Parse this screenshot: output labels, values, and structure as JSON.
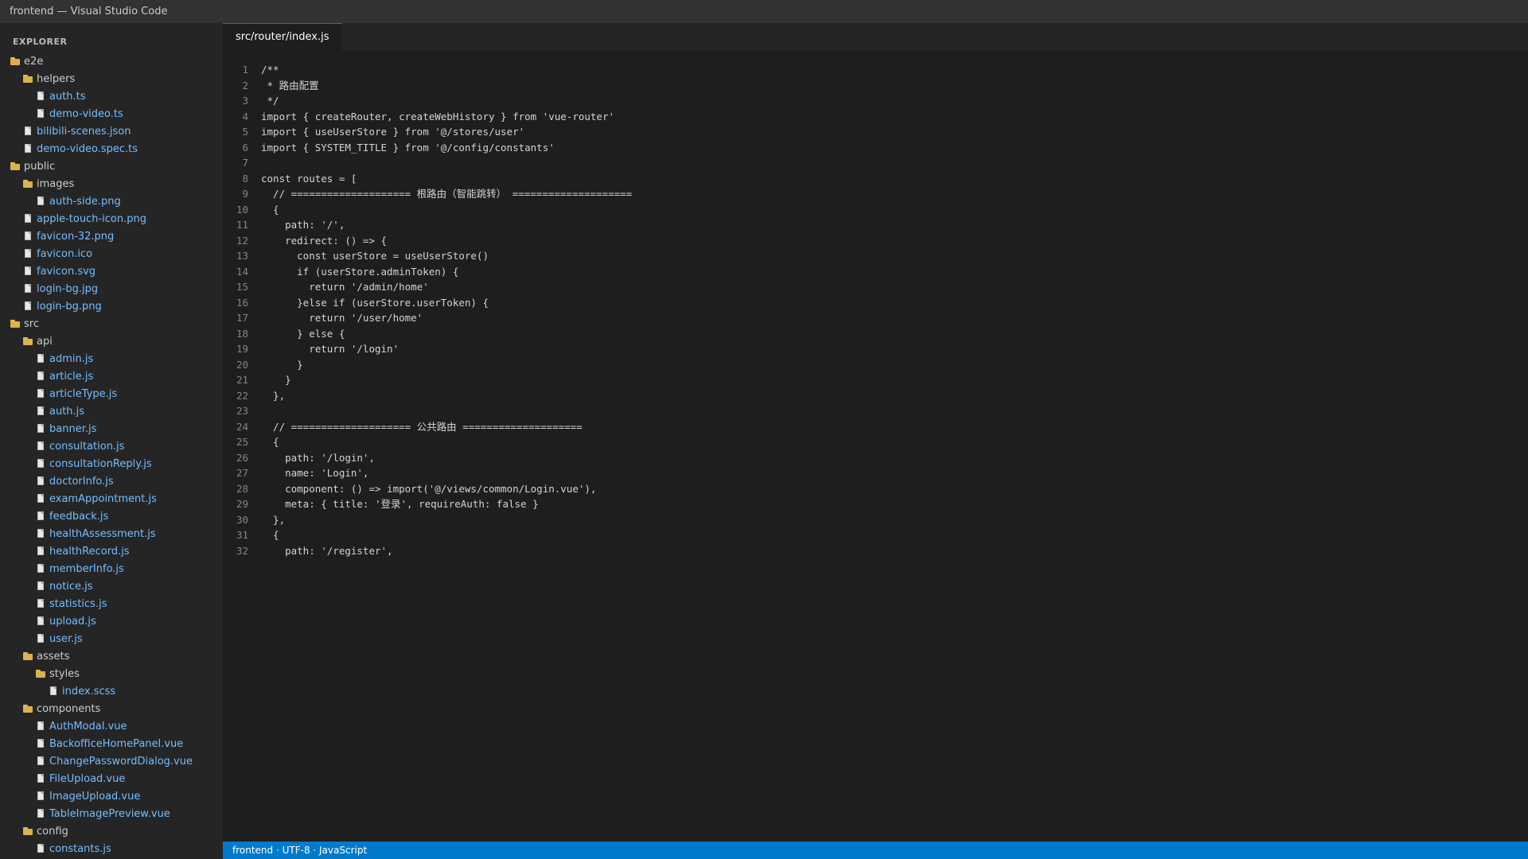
{
  "window": {
    "title": "frontend — Visual Studio Code"
  },
  "sidebar": {
    "title": "EXPLORER",
    "tree": [
      {
        "name": "e2e",
        "type": "folder",
        "depth": 0
      },
      {
        "name": "helpers",
        "type": "folder",
        "depth": 1
      },
      {
        "name": "auth.ts",
        "type": "file",
        "depth": 2
      },
      {
        "name": "demo-video.ts",
        "type": "file",
        "depth": 2
      },
      {
        "name": "bilibili-scenes.json",
        "type": "file",
        "depth": 1
      },
      {
        "name": "demo-video.spec.ts",
        "type": "file",
        "depth": 1
      },
      {
        "name": "public",
        "type": "folder",
        "depth": 0
      },
      {
        "name": "images",
        "type": "folder",
        "depth": 1
      },
      {
        "name": "auth-side.png",
        "type": "file",
        "depth": 2
      },
      {
        "name": "apple-touch-icon.png",
        "type": "file",
        "depth": 1
      },
      {
        "name": "favicon-32.png",
        "type": "file",
        "depth": 1
      },
      {
        "name": "favicon.ico",
        "type": "file",
        "depth": 1
      },
      {
        "name": "favicon.svg",
        "type": "file",
        "depth": 1
      },
      {
        "name": "login-bg.jpg",
        "type": "file",
        "depth": 1
      },
      {
        "name": "login-bg.png",
        "type": "file",
        "depth": 1
      },
      {
        "name": "src",
        "type": "folder",
        "depth": 0
      },
      {
        "name": "api",
        "type": "folder",
        "depth": 1
      },
      {
        "name": "admin.js",
        "type": "file",
        "depth": 2
      },
      {
        "name": "article.js",
        "type": "file",
        "depth": 2
      },
      {
        "name": "articleType.js",
        "type": "file",
        "depth": 2
      },
      {
        "name": "auth.js",
        "type": "file",
        "depth": 2
      },
      {
        "name": "banner.js",
        "type": "file",
        "depth": 2
      },
      {
        "name": "consultation.js",
        "type": "file",
        "depth": 2
      },
      {
        "name": "consultationReply.js",
        "type": "file",
        "depth": 2
      },
      {
        "name": "doctorInfo.js",
        "type": "file",
        "depth": 2
      },
      {
        "name": "examAppointment.js",
        "type": "file",
        "depth": 2
      },
      {
        "name": "feedback.js",
        "type": "file",
        "depth": 2
      },
      {
        "name": "healthAssessment.js",
        "type": "file",
        "depth": 2
      },
      {
        "name": "healthRecord.js",
        "type": "file",
        "depth": 2
      },
      {
        "name": "memberInfo.js",
        "type": "file",
        "depth": 2
      },
      {
        "name": "notice.js",
        "type": "file",
        "depth": 2
      },
      {
        "name": "statistics.js",
        "type": "file",
        "depth": 2
      },
      {
        "name": "upload.js",
        "type": "file",
        "depth": 2
      },
      {
        "name": "user.js",
        "type": "file",
        "depth": 2
      },
      {
        "name": "assets",
        "type": "folder",
        "depth": 1
      },
      {
        "name": "styles",
        "type": "folder",
        "depth": 2
      },
      {
        "name": "index.scss",
        "type": "file",
        "depth": 3
      },
      {
        "name": "components",
        "type": "folder",
        "depth": 1
      },
      {
        "name": "AuthModal.vue",
        "type": "file",
        "depth": 2
      },
      {
        "name": "BackofficeHomePanel.vue",
        "type": "file",
        "depth": 2
      },
      {
        "name": "ChangePasswordDialog.vue",
        "type": "file",
        "depth": 2
      },
      {
        "name": "FileUpload.vue",
        "type": "file",
        "depth": 2
      },
      {
        "name": "ImageUpload.vue",
        "type": "file",
        "depth": 2
      },
      {
        "name": "TableImagePreview.vue",
        "type": "file",
        "depth": 2
      },
      {
        "name": "config",
        "type": "folder",
        "depth": 1
      },
      {
        "name": "constants.js",
        "type": "file",
        "depth": 2
      }
    ]
  },
  "editor": {
    "active_tab": "src/router/index.js",
    "lines": [
      "/**",
      " * 路由配置",
      " */",
      "import { createRouter, createWebHistory } from 'vue-router'",
      "import { useUserStore } from '@/stores/user'",
      "import { SYSTEM_TITLE } from '@/config/constants'",
      "",
      "const routes = [",
      "  // ==================== 根路由（智能跳转） ====================",
      "  {",
      "    path: '/',",
      "    redirect: () => {",
      "      const userStore = useUserStore()",
      "      if (userStore.adminToken) {",
      "        return '/admin/home'",
      "      }else if (userStore.userToken) {",
      "        return '/user/home'",
      "      } else {",
      "        return '/login'",
      "      }",
      "    }",
      "  },",
      "",
      "  // ==================== 公共路由 ====================",
      "  {",
      "    path: '/login',",
      "    name: 'Login',",
      "    component: () => import('@/views/common/Login.vue'),",
      "    meta: { title: '登录', requireAuth: false }",
      "  },",
      "  {",
      "    path: '/register',"
    ]
  },
  "statusbar": {
    "text": "frontend · UTF-8 · JavaScript"
  },
  "colors": {
    "accent": "#007acc",
    "file_label": "#75beff",
    "folder_icon": "#dcb24c"
  },
  "icons": {
    "folder": "folder-icon",
    "file": "file-icon"
  }
}
